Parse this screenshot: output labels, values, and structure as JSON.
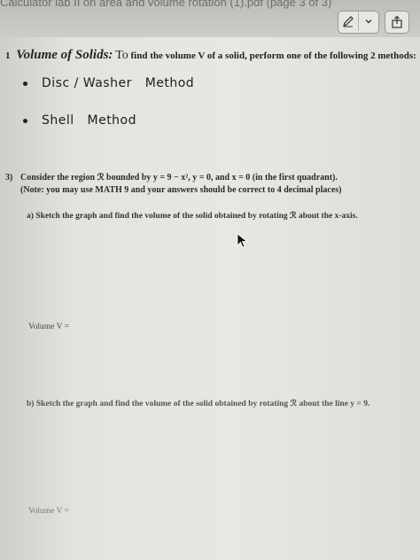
{
  "window": {
    "title": "Calculator lab II on area and volume rotation (1).pdf (page 3 of 3)"
  },
  "toolbar": {
    "icons": [
      "pencil-markup-icon",
      "chevron-down-icon",
      "share-icon"
    ]
  },
  "section": {
    "number": "1",
    "title": "Volume of Solids:",
    "instruction_lead": "To",
    "instruction": "find the volume V of a solid, perform one of the following 2 methods:"
  },
  "methods": [
    {
      "label": "Disc / Washer   Method"
    },
    {
      "label": "Shell   Method"
    }
  ],
  "problem": {
    "number": "3)",
    "statement": "Consider the region ℛ bounded by y = 9 − x², y = 0, and x = 0 (in the first quadrant).",
    "note": "(Note: you may use MATH 9 and your answers should be correct to 4 decimal places)"
  },
  "part_a": {
    "text": "a) Sketch the graph and find the volume of the solid obtained by rotating ℛ about the x-axis.",
    "volume_label": "Volume V ="
  },
  "part_b": {
    "text": "b) Sketch the graph and find the volume of the solid obtained by rotating ℛ about the line y = 9.",
    "volume_label": "Volume V ="
  }
}
